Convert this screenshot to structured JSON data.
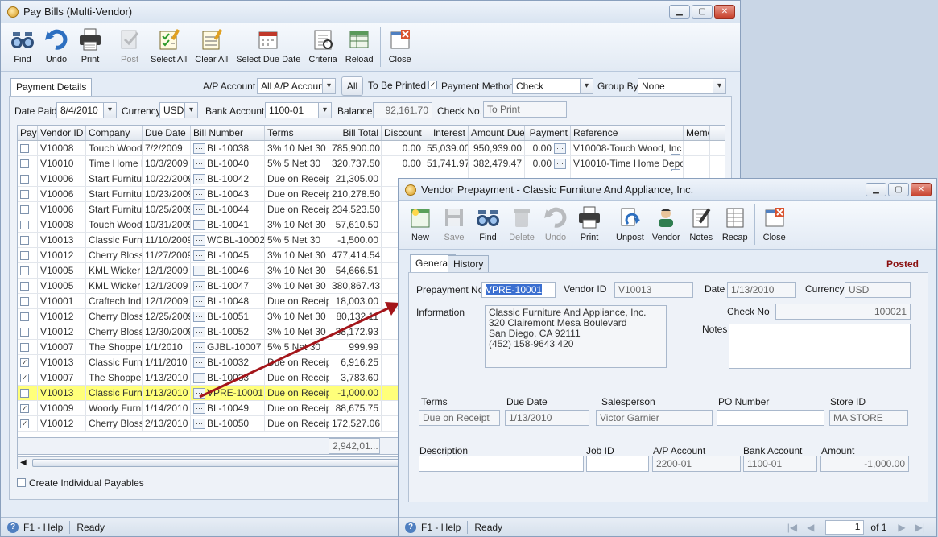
{
  "pay_bills": {
    "title": "Pay Bills (Multi-Vendor)",
    "toolbar": [
      "Find",
      "Undo",
      "Print",
      "Post",
      "Select All",
      "Clear All",
      "Select Due Date",
      "Criteria",
      "Reload",
      "Close"
    ],
    "tab": "Payment Details",
    "ap_account_label": "A/P Account",
    "ap_account_value": "All A/P Accounts",
    "all_button": "All",
    "to_be_printed": "To Be Printed",
    "payment_method_label": "Payment Method",
    "payment_method_value": "Check",
    "group_by_label": "Group By",
    "group_by_value": "None",
    "date_paid_label": "Date Paid",
    "date_paid_value": "8/4/2010",
    "currency_label": "Currency",
    "currency_value": "USD",
    "bank_account_label": "Bank Account",
    "bank_account_value": "1100-01",
    "balance_label": "Balance",
    "balance_value": "92,161.70",
    "check_no_label": "Check No.",
    "check_no_value": "To Print",
    "columns": [
      "Pay",
      "Vendor ID",
      "Company",
      "Due Date",
      "Bill Number",
      "Terms",
      "Bill Total",
      "Discount",
      "Interest",
      "Amount Due",
      "Payment",
      "Reference",
      "Memo"
    ],
    "rows": [
      {
        "pay": false,
        "vendor": "V10008",
        "company": "Touch Wood,",
        "due": "7/2/2009",
        "bill": "BL-10038",
        "terms": "3% 10 Net 30",
        "total": "785,900.00",
        "discount": "0.00",
        "interest": "55,039.00",
        "amount_due": "950,939.00",
        "payment": "0.00",
        "reference": "V10008-Touch Wood, Inc"
      },
      {
        "pay": false,
        "vendor": "V10010",
        "company": "Time Home De",
        "due": "10/3/2009",
        "bill": "BL-10040",
        "terms": "5% 5 Net 30",
        "total": "320,737.50",
        "discount": "0.00",
        "interest": "51,741.97",
        "amount_due": "382,479.47",
        "payment": "0.00",
        "reference": "V10010-Time Home Depo"
      },
      {
        "pay": false,
        "vendor": "V10006",
        "company": "Start Furnitur",
        "due": "10/22/2009",
        "bill": "BL-10042",
        "terms": "Due on Receipt",
        "total": "21,305.00",
        "discount": "",
        "interest": "",
        "amount_due": "",
        "payment": "",
        "reference": ""
      },
      {
        "pay": false,
        "vendor": "V10006",
        "company": "Start Furnitur",
        "due": "10/23/2009",
        "bill": "BL-10043",
        "terms": "Due on Receipt",
        "total": "210,278.50",
        "discount": "",
        "interest": "",
        "amount_due": "",
        "payment": "",
        "reference": ""
      },
      {
        "pay": false,
        "vendor": "V10006",
        "company": "Start Furnitur",
        "due": "10/25/2009",
        "bill": "BL-10044",
        "terms": "Due on Receipt",
        "total": "234,523.50",
        "discount": "",
        "interest": "",
        "amount_due": "",
        "payment": "",
        "reference": ""
      },
      {
        "pay": false,
        "vendor": "V10008",
        "company": "Touch Wood,",
        "due": "10/31/2009",
        "bill": "BL-10041",
        "terms": "3% 10 Net 30",
        "total": "57,610.50",
        "discount": "",
        "interest": "",
        "amount_due": "",
        "payment": "",
        "reference": ""
      },
      {
        "pay": false,
        "vendor": "V10013",
        "company": "Classic Furnit",
        "due": "11/10/2009",
        "bill": "WCBL-10002",
        "terms": "5% 5 Net 30",
        "total": "-1,500.00",
        "discount": "",
        "interest": "",
        "amount_due": "",
        "payment": "",
        "reference": ""
      },
      {
        "pay": false,
        "vendor": "V10012",
        "company": "Cherry Blossc",
        "due": "11/27/2009",
        "bill": "BL-10045",
        "terms": "3% 10 Net 30",
        "total": "477,414.54",
        "discount": "",
        "interest": "",
        "amount_due": "",
        "payment": "",
        "reference": ""
      },
      {
        "pay": false,
        "vendor": "V10005",
        "company": "KML Wicker &",
        "due": "12/1/2009",
        "bill": "BL-10046",
        "terms": "3% 10 Net 30",
        "total": "54,666.51",
        "discount": "",
        "interest": "",
        "amount_due": "",
        "payment": "",
        "reference": ""
      },
      {
        "pay": false,
        "vendor": "V10005",
        "company": "KML Wicker &",
        "due": "12/1/2009",
        "bill": "BL-10047",
        "terms": "3% 10 Net 30",
        "total": "380,867.43",
        "discount": "",
        "interest": "",
        "amount_due": "",
        "payment": "",
        "reference": ""
      },
      {
        "pay": false,
        "vendor": "V10001",
        "company": "Craftech Indu",
        "due": "12/1/2009",
        "bill": "BL-10048",
        "terms": "Due on Receipt",
        "total": "18,003.00",
        "discount": "",
        "interest": "",
        "amount_due": "",
        "payment": "",
        "reference": ""
      },
      {
        "pay": false,
        "vendor": "V10012",
        "company": "Cherry Blossc",
        "due": "12/25/2009",
        "bill": "BL-10051",
        "terms": "3% 10 Net 30",
        "total": "80,132.11",
        "discount": "",
        "interest": "",
        "amount_due": "",
        "payment": "",
        "reference": ""
      },
      {
        "pay": false,
        "vendor": "V10012",
        "company": "Cherry Blossc",
        "due": "12/30/2009",
        "bill": "BL-10052",
        "terms": "3% 10 Net 30",
        "total": "38,172.93",
        "discount": "",
        "interest": "",
        "amount_due": "",
        "payment": "",
        "reference": ""
      },
      {
        "pay": false,
        "vendor": "V10007",
        "company": "The Shoppe",
        "due": "1/1/2010",
        "bill": "GJBL-10007",
        "terms": "5% 5 Net 30",
        "total": "999.99",
        "discount": "",
        "interest": "",
        "amount_due": "",
        "payment": "",
        "reference": ""
      },
      {
        "pay": true,
        "vendor": "V10013",
        "company": "Classic Furnit",
        "due": "1/11/2010",
        "bill": "BL-10032",
        "terms": "Due on Receipt",
        "total": "6,916.25",
        "discount": "",
        "interest": "",
        "amount_due": "",
        "payment": "",
        "reference": ""
      },
      {
        "pay": true,
        "vendor": "V10007",
        "company": "The Shoppe",
        "due": "1/13/2010",
        "bill": "BL-10033",
        "terms": "Due on Receipt",
        "total": "3,783.60",
        "discount": "",
        "interest": "",
        "amount_due": "",
        "payment": "",
        "reference": ""
      },
      {
        "pay": false,
        "vendor": "V10013",
        "company": "Classic Furnit",
        "due": "1/13/2010",
        "bill": "VPRE-10001",
        "terms": "Due on Receipt",
        "total": "-1,000.00",
        "discount": "",
        "interest": "",
        "amount_due": "",
        "payment": "",
        "reference": "",
        "highlight": true
      },
      {
        "pay": true,
        "vendor": "V10009",
        "company": "Woody Furnit",
        "due": "1/14/2010",
        "bill": "BL-10049",
        "terms": "Due on Receipt",
        "total": "88,675.75",
        "discount": "",
        "interest": "",
        "amount_due": "",
        "payment": "",
        "reference": ""
      },
      {
        "pay": true,
        "vendor": "V10012",
        "company": "Cherry Blossc",
        "due": "2/13/2010",
        "bill": "BL-10050",
        "terms": "Due on Receipt",
        "total": "172,527.06",
        "discount": "",
        "interest": "",
        "amount_due": "",
        "payment": "",
        "reference": ""
      }
    ],
    "total_bill": "2,942,01...",
    "create_individual": "Create Individual Payables",
    "status_help": "F1 - Help",
    "status_ready": "Ready"
  },
  "vendor_prepayment": {
    "title": "Vendor Prepayment - Classic Furniture And Appliance, Inc.",
    "toolbar": [
      "New",
      "Save",
      "Find",
      "Delete",
      "Undo",
      "Print",
      "Unpost",
      "Vendor",
      "Notes",
      "Recap",
      "Close"
    ],
    "tabs": [
      "General",
      "History"
    ],
    "posted": "Posted",
    "prepayment_no_label": "Prepayment No.",
    "prepayment_no_value": "VPRE-10001",
    "vendor_id_label": "Vendor  ID",
    "vendor_id_value": "V10013",
    "date_label": "Date",
    "date_value": "1/13/2010",
    "currency_label": "Currency",
    "currency_value": "USD",
    "information_label": "Information",
    "information_lines": [
      "Classic Furniture And Appliance, Inc.",
      "320 Clairemont Mesa Boulevard",
      "San Diego, CA 92111",
      "(452) 158-9643 420"
    ],
    "check_no_label": "Check No",
    "check_no_value": "100021",
    "notes_label": "Notes",
    "terms_label": "Terms",
    "terms_value": "Due on Receipt",
    "due_date_label": "Due Date",
    "due_date_value": "1/13/2010",
    "salesperson_label": "Salesperson",
    "salesperson_value": "Victor Garnier",
    "po_number_label": "PO Number",
    "po_number_value": "",
    "store_id_label": "Store ID",
    "store_id_value": "MA STORE",
    "description_label": "Description",
    "description_value": "",
    "job_id_label": "Job ID",
    "job_id_value": "",
    "ap_account_label": "A/P Account",
    "ap_account_value": "2200-01",
    "bank_account_label": "Bank Account",
    "bank_account_value": "1100-01",
    "amount_label": "Amount",
    "amount_value": "-1,000.00",
    "status_help": "F1 - Help",
    "status_ready": "Ready",
    "page_value": "1",
    "page_of": "of 1"
  }
}
